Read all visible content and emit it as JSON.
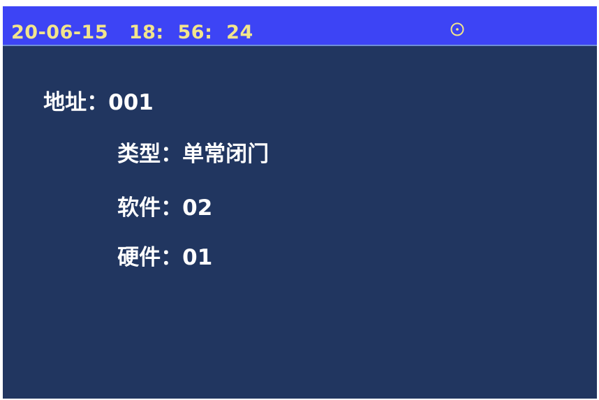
{
  "status_bar": {
    "datetime": "20-06-15   18:  56:  24",
    "icon": "circle-dot-icon"
  },
  "info": {
    "address_label": "地址：",
    "address_value": "001",
    "type_label": "类型：",
    "type_value": "单常闭门",
    "software_label": "软件：",
    "software_value": "02",
    "hardware_label": "硬件：",
    "hardware_value": "01"
  },
  "colors": {
    "status_bar_bg": "#3d44f5",
    "screen_bg": "#213660",
    "datetime_text": "#f2e58c",
    "body_text": "#ffffff"
  }
}
